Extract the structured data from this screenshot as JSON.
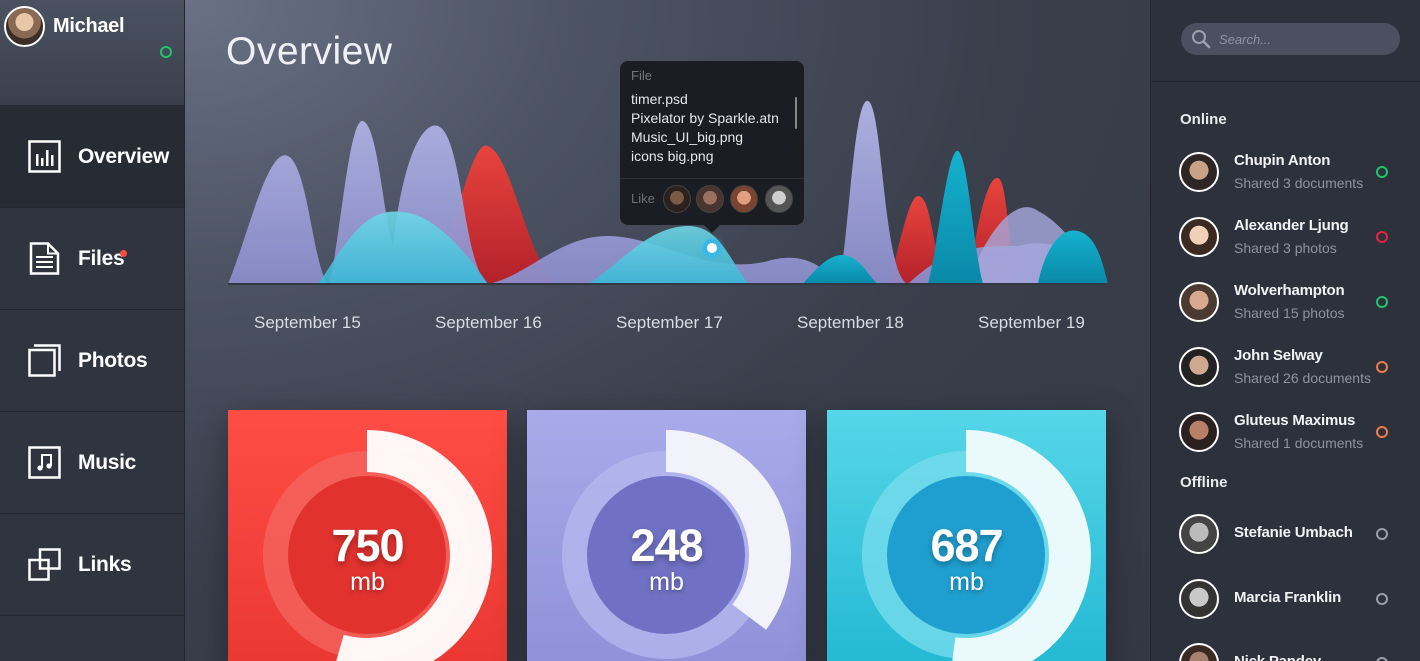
{
  "user": {
    "name": "Michael",
    "status_color": "#22c36b"
  },
  "nav": [
    {
      "label": "Overview",
      "icon": "bar-chart-icon",
      "active": true
    },
    {
      "label": "Files",
      "icon": "document-icon",
      "badge": true
    },
    {
      "label": "Photos",
      "icon": "photos-icon"
    },
    {
      "label": "Music",
      "icon": "music-icon"
    },
    {
      "label": "Links",
      "icon": "links-icon"
    }
  ],
  "main": {
    "title": "Overview",
    "dates": [
      "September 15",
      "September 16",
      "September 17",
      "September 18",
      "September 19"
    ]
  },
  "tooltip": {
    "header": "File",
    "files": [
      "timer.psd",
      "Pixelator by Sparkle.atn",
      "Music_UI_big.png",
      "icons big.png"
    ],
    "like_label": "Like"
  },
  "stats": [
    {
      "value": "750",
      "unit": "mb",
      "color": "#f0403a",
      "fraction": 0.55
    },
    {
      "value": "248",
      "unit": "mb",
      "color": "#8f8fd9",
      "fraction": 0.35
    },
    {
      "value": "687",
      "unit": "mb",
      "color": "#2bc4dd",
      "fraction": 0.52
    }
  ],
  "search": {
    "placeholder": "Search..."
  },
  "online_label": "Online",
  "offline_label": "Offline",
  "online": [
    {
      "name": "Chupin Anton",
      "detail": "Shared 3 documents",
      "status_color": "#22c36b"
    },
    {
      "name": "Alexander Ljung",
      "detail": "Shared 3 photos",
      "status_color": "#e8223c"
    },
    {
      "name": "Wolverhampton",
      "detail": "Shared 15 photos",
      "status_color": "#22c36b"
    },
    {
      "name": "John Selway",
      "detail": "Shared 26 documents",
      "status_color": "#f07a4a"
    },
    {
      "name": "Gluteus Maximus",
      "detail": "Shared 1 documents",
      "status_color": "#f07a4a"
    }
  ],
  "offline": [
    {
      "name": "Stefanie Umbach",
      "status_color": "#9a9ea8"
    },
    {
      "name": "Marcia Franklin",
      "status_color": "#9a9ea8"
    },
    {
      "name": "Nick Pandey",
      "status_color": "#9a9ea8"
    }
  ]
}
